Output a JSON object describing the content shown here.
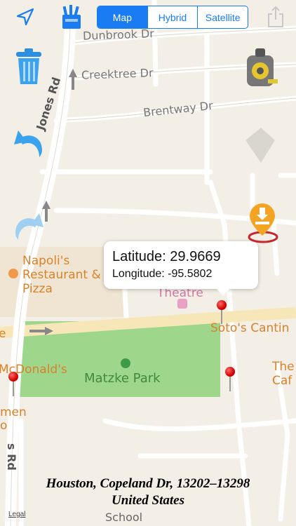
{
  "toolbar": {
    "locate_icon": "location-arrow-icon",
    "pencil_cup_icon": "pencil-cup-icon",
    "share_icon": "share-icon",
    "map_types": [
      {
        "label": "Map",
        "active": true
      },
      {
        "label": "Hybrid",
        "active": false
      },
      {
        "label": "Satellite",
        "active": false
      }
    ]
  },
  "side_tools": {
    "trash_icon": "trash-icon",
    "undo_icon": "undo-arrow-icon",
    "redo_icon": "redo-arrow-icon",
    "tape_measure_icon": "tape-measure-icon",
    "download_pin_icon": "download-pin-icon"
  },
  "map": {
    "streets": [
      "Dunbrook Dr",
      "Creektree Dr",
      "Brentway Dr",
      "Jones Rd",
      "s Rd"
    ],
    "pois": {
      "napoli_1": "Napoli's",
      "napoli_2": "Restaurant &",
      "napoli_3": "Pizza",
      "theatre": "Theatre",
      "sotos": "Soto's Cantin",
      "mcdonalds": "McDonald's",
      "park": "Matzke Park",
      "the": "The",
      "cafe": "Caf",
      "men": "men",
      "o": "o",
      "school": "School",
      "e": "e"
    }
  },
  "callout": {
    "latitude": "Latitude: 29.9669",
    "longitude": "Longitude: -95.5802"
  },
  "address": {
    "line1": "Houston, Copeland Dr, 13202–13298",
    "line2": "United States"
  },
  "legal": "Legal",
  "colors": {
    "accent": "#1a7cf3",
    "park": "#9ed68c",
    "road": "#ffffff",
    "major_road": "#f6e6b8",
    "land": "#f3efe6",
    "pin": "#d40000"
  }
}
